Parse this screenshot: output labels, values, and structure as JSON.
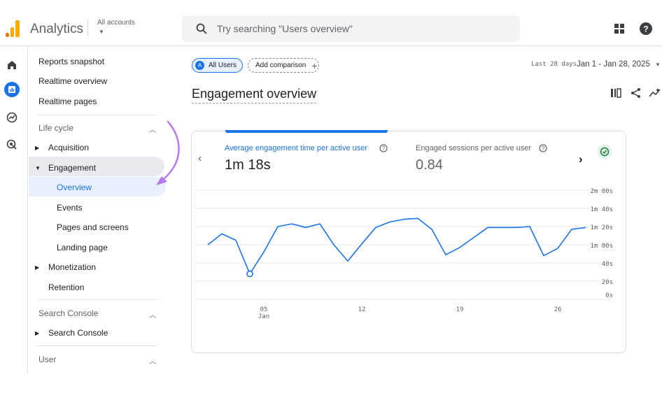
{
  "topbar": {
    "app_name": "Analytics",
    "account_label": "All accounts",
    "search_placeholder": "Try searching \"Users overview\"",
    "colors": {
      "logo_orange": "#f9ab00",
      "logo_dark": "#e37400"
    }
  },
  "rail": {
    "icons": [
      "home-icon",
      "reports-icon",
      "explore-icon",
      "advertising-icon"
    ],
    "active": "reports-icon",
    "accent": "#1a73e8"
  },
  "sidebar": {
    "top_items": [
      "Reports snapshot",
      "Realtime overview",
      "Realtime pages"
    ],
    "lifecycle": {
      "header": "Life cycle",
      "acquisition": "Acquisition",
      "engagement": "Engagement",
      "engagement_children": [
        "Overview",
        "Events",
        "Pages and screens",
        "Landing page"
      ],
      "active_child": "Overview",
      "monetization": "Monetization",
      "retention": "Retention"
    },
    "search_console": {
      "header": "Search Console",
      "item": "Search Console"
    },
    "user": {
      "header": "User"
    }
  },
  "toolbar": {
    "chip_all_badge": "A",
    "chip_all_label": "All Users",
    "add_comparison": "Add comparison",
    "date_range_label": "Last 28 days",
    "date_range_value": "Jan 1 - Jan 28, 2025"
  },
  "page": {
    "title": "Engagement overview"
  },
  "card": {
    "metric1": {
      "label": "Average engagement time per active user",
      "value": "1m 18s"
    },
    "metric2": {
      "label": "Engaged sessions per active user",
      "value": "0.84"
    }
  },
  "chart_data": {
    "type": "line",
    "y_axis_position": "right",
    "y_tick_labels": [
      "0s",
      "20s",
      "40s",
      "1m 00s",
      "1m 20s",
      "1m 40s",
      "2m 00s"
    ],
    "ylim_seconds": [
      0,
      120
    ],
    "x_tick_labels": [
      {
        "day": 5,
        "label": "05",
        "sub": "Jan"
      },
      {
        "day": 12,
        "label": "12"
      },
      {
        "day": 19,
        "label": "19"
      },
      {
        "day": 26,
        "label": "26"
      }
    ],
    "x_days": [
      1,
      2,
      3,
      4,
      5,
      6,
      7,
      8,
      9,
      10,
      11,
      12,
      13,
      14,
      15,
      16,
      17,
      18,
      19,
      20,
      21,
      22,
      23,
      24,
      25,
      26,
      27,
      28
    ],
    "values_seconds": [
      60,
      72,
      65,
      28,
      52,
      80,
      83,
      79,
      83,
      60,
      42,
      61,
      79,
      85,
      88,
      89,
      77,
      49,
      57,
      68,
      79,
      79,
      79,
      80,
      48,
      56,
      77,
      79
    ],
    "highlight_day": 4,
    "line_color": "#1a73e8",
    "grid": true
  }
}
